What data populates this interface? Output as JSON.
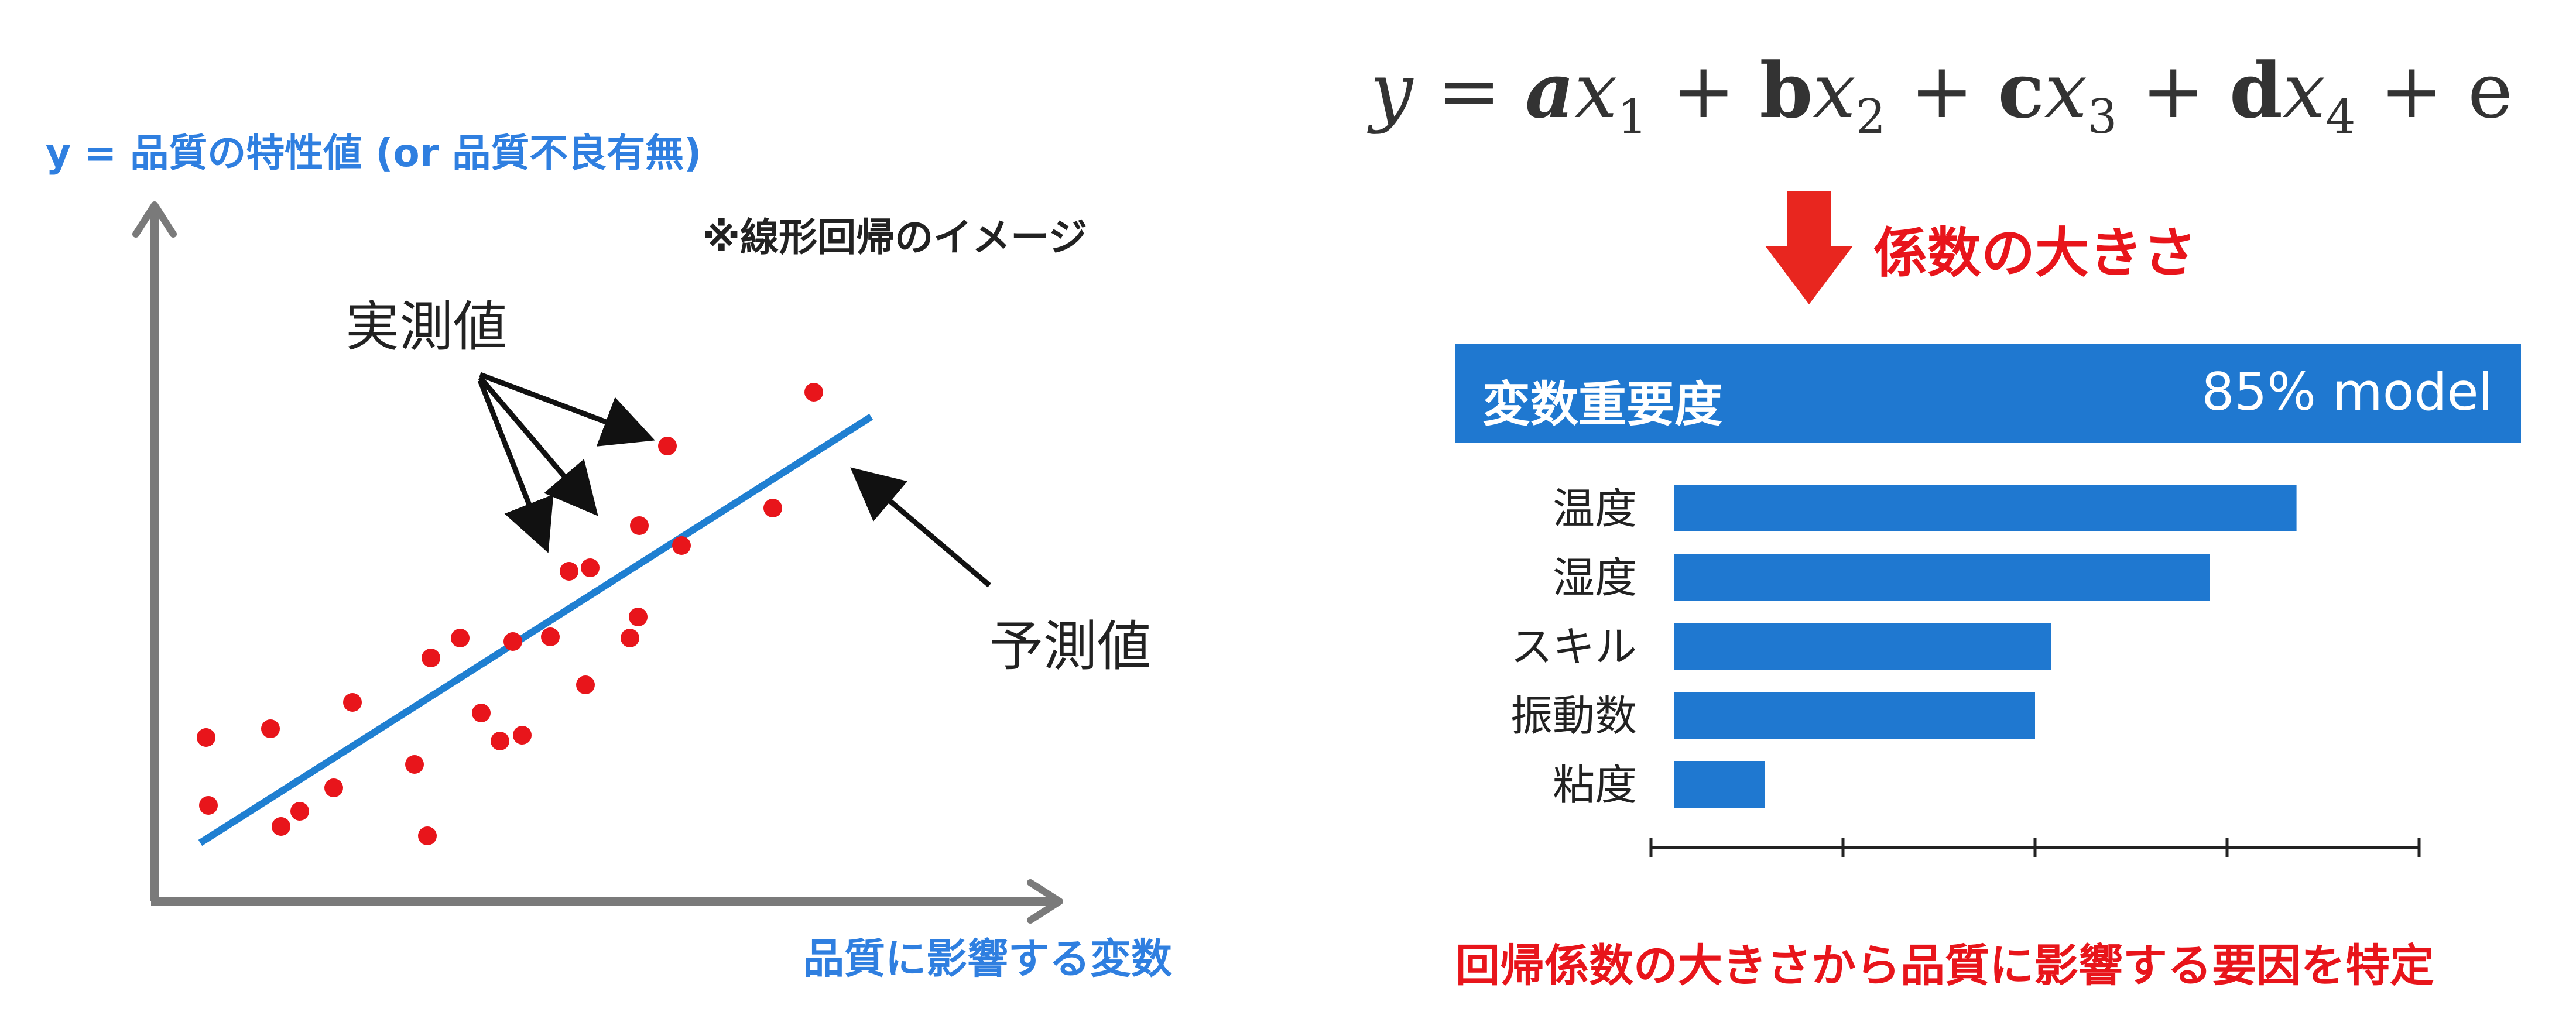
{
  "left_chart": {
    "y_axis_label": "y = 品質の特性値 (or 品質不良有無)",
    "x_axis_label": "品質に影響する変数",
    "note": "※線形回帰のイメージ",
    "observed_label": "実測値",
    "predicted_label": "予測値",
    "colors": {
      "points": "#e8151b",
      "regression_line": "#1f7fd1",
      "axes": "#7a7a7a",
      "axis_text": "#2f7fe0"
    }
  },
  "equation": {
    "y": "y",
    "equals": "=",
    "plus": "+",
    "terms": [
      {
        "coef": "a",
        "var": "x",
        "sub": "1"
      },
      {
        "coef": "b",
        "var": "x",
        "sub": "2"
      },
      {
        "coef": "c",
        "var": "x",
        "sub": "3"
      },
      {
        "coef": "d",
        "var": "x",
        "sub": "4"
      }
    ],
    "error": "e"
  },
  "arrow_label": "係数の大きさ",
  "importance_panel": {
    "title": "変数重要度",
    "model": "85% model",
    "header_color": "#1f78d0"
  },
  "chart_data": {
    "type": "bar",
    "orientation": "horizontal",
    "categories": [
      "温度",
      "湿度",
      "スキル",
      "振動数",
      "粘度"
    ],
    "values": [
      3.45,
      2.97,
      2.09,
      2.0,
      0.5
    ],
    "xlim": [
      0,
      4
    ],
    "ticks": [
      0,
      1,
      2,
      3,
      4
    ],
    "tick_labels_shown": false,
    "bar_color": "#1f78d0",
    "title": "変数重要度",
    "grid": false,
    "legend": "none"
  },
  "conclusion": "回帰係数の大きさから品質に影響する要因を特定"
}
